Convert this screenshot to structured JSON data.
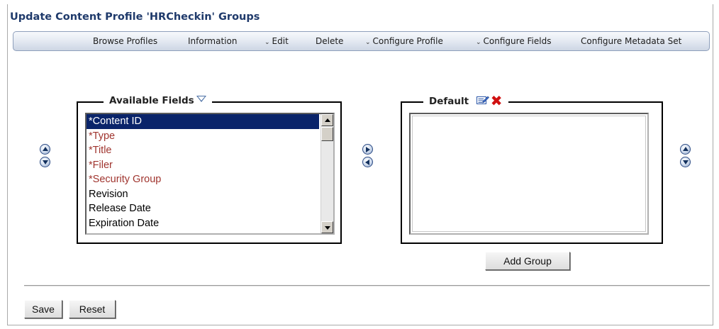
{
  "page_title": "Update Content Profile 'HRCheckin' Groups",
  "menu": [
    {
      "label": "Browse Profiles",
      "dropdown": false
    },
    {
      "label": "Information",
      "dropdown": false
    },
    {
      "label": "Edit",
      "dropdown": true
    },
    {
      "label": "Delete",
      "dropdown": false
    },
    {
      "label": "Configure Profile",
      "dropdown": true
    },
    {
      "label": "Configure Fields",
      "dropdown": true
    },
    {
      "label": "Configure Metadata Set",
      "dropdown": false
    }
  ],
  "available_fields": {
    "legend": "Available Fields",
    "items": [
      {
        "label": "*Content ID",
        "required": true,
        "selected": true
      },
      {
        "label": "*Type",
        "required": true,
        "selected": false
      },
      {
        "label": "*Title",
        "required": true,
        "selected": false
      },
      {
        "label": "*Filer",
        "required": true,
        "selected": false
      },
      {
        "label": "*Security Group",
        "required": true,
        "selected": false
      },
      {
        "label": "Revision",
        "required": false,
        "selected": false
      },
      {
        "label": "Release Date",
        "required": false,
        "selected": false
      },
      {
        "label": "Expiration Date",
        "required": false,
        "selected": false
      }
    ]
  },
  "default_group": {
    "legend": "Default",
    "items": []
  },
  "buttons": {
    "add_group": "Add Group",
    "save": "Save",
    "reset": "Reset"
  },
  "colors": {
    "title": "#1f3a6b",
    "required_field": "#a0352f",
    "selected_bg": "#0a246a",
    "delete_icon": "#d01010"
  }
}
